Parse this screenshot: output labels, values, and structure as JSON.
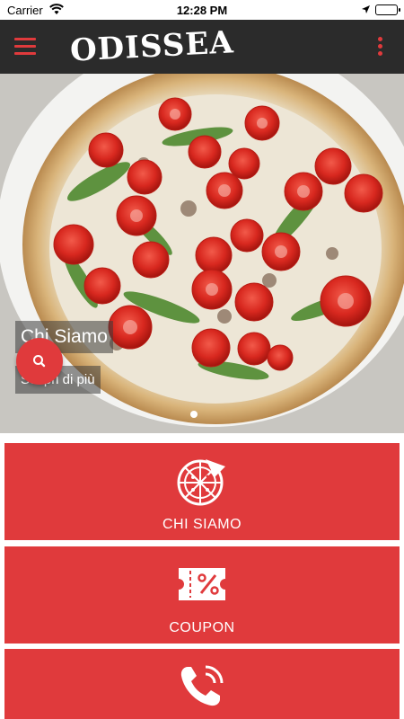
{
  "status_bar": {
    "carrier": "Carrier",
    "time": "12:28 PM"
  },
  "app_bar": {
    "logo": "ODISSEA",
    "menu_icon": "hamburger-menu-icon",
    "overflow_icon": "more-vertical-icon"
  },
  "hero": {
    "title": "Chi Siamo",
    "button_label": "Scopri di più",
    "search_icon": "search-icon"
  },
  "tiles": [
    {
      "label": "CHI SIAMO",
      "icon": "pizza-icon"
    },
    {
      "label": "COUPON",
      "icon": "coupon-icon"
    },
    {
      "label": "",
      "icon": "phone-icon"
    }
  ],
  "colors": {
    "accent": "#e03a3c",
    "app_bar": "#2b2b2b",
    "tile_bg": "#e03a3c"
  }
}
